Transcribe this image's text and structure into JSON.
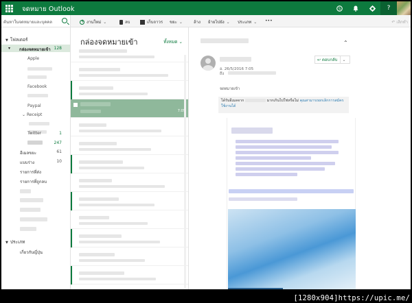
{
  "app": {
    "title": "จดหมาย Outlook"
  },
  "topbar": {
    "icons": [
      "skype-icon",
      "bell-icon",
      "gear-icon",
      "help-icon"
    ],
    "help_label": "?"
  },
  "search": {
    "placeholder": "ค้นหาในจดหมายและบุคคล"
  },
  "commands": {
    "new": "งานใหม่",
    "delete": "ลบ",
    "archive": "เก็บถาวร",
    "junk": "ขยะ",
    "sweep": "ล้าง",
    "move": "ย้ายไปยัง",
    "categorize": "ประเภท",
    "more": "•••",
    "undo": "เลิกทำ"
  },
  "nav": {
    "folders_header": "โฟลเดอร์",
    "inbox_label": "กล่องจดหมายเข้า",
    "inbox_count": "128",
    "subfolders": [
      "Apple",
      "Facebook",
      "Paypal",
      "Receipt",
      "Twitter"
    ],
    "twitter_count": "1",
    "hidden_count": "247",
    "junk_label": "อีเมลขยะ",
    "junk_count": "61",
    "drafts_label": "แบบร่าง",
    "drafts_count": "10",
    "sent_label": "รายการที่ส่ง",
    "deleted_label": "รายการที่ถูกลบ",
    "groups_header": "ประเภท",
    "groups_item": "เกี่ยวกับญี่ปุ่น"
  },
  "list": {
    "title": "กล่องจดหมายเข้า",
    "filter": "ทั้งหมด",
    "selected_time": "7:05"
  },
  "reading": {
    "date": "อ. 26/5/2016 7:05",
    "to_label": "ถึง",
    "reply_label": "ตอบกลับ",
    "folder_tag": "จดหมายเข้า",
    "notice_text": "ได้รับอีเมลจาก",
    "notice_text2": "มากเกินไปใช่หรือไม่",
    "notice_link": "คุณสามารถยกเลิกการสมัครใช้งานได้"
  },
  "watermark": "[1280x904]https://upic.me/",
  "colors": {
    "accent": "#0d7a3e",
    "selected_msg": "#8fb89b",
    "nav_selected": "#dbe9dd"
  }
}
